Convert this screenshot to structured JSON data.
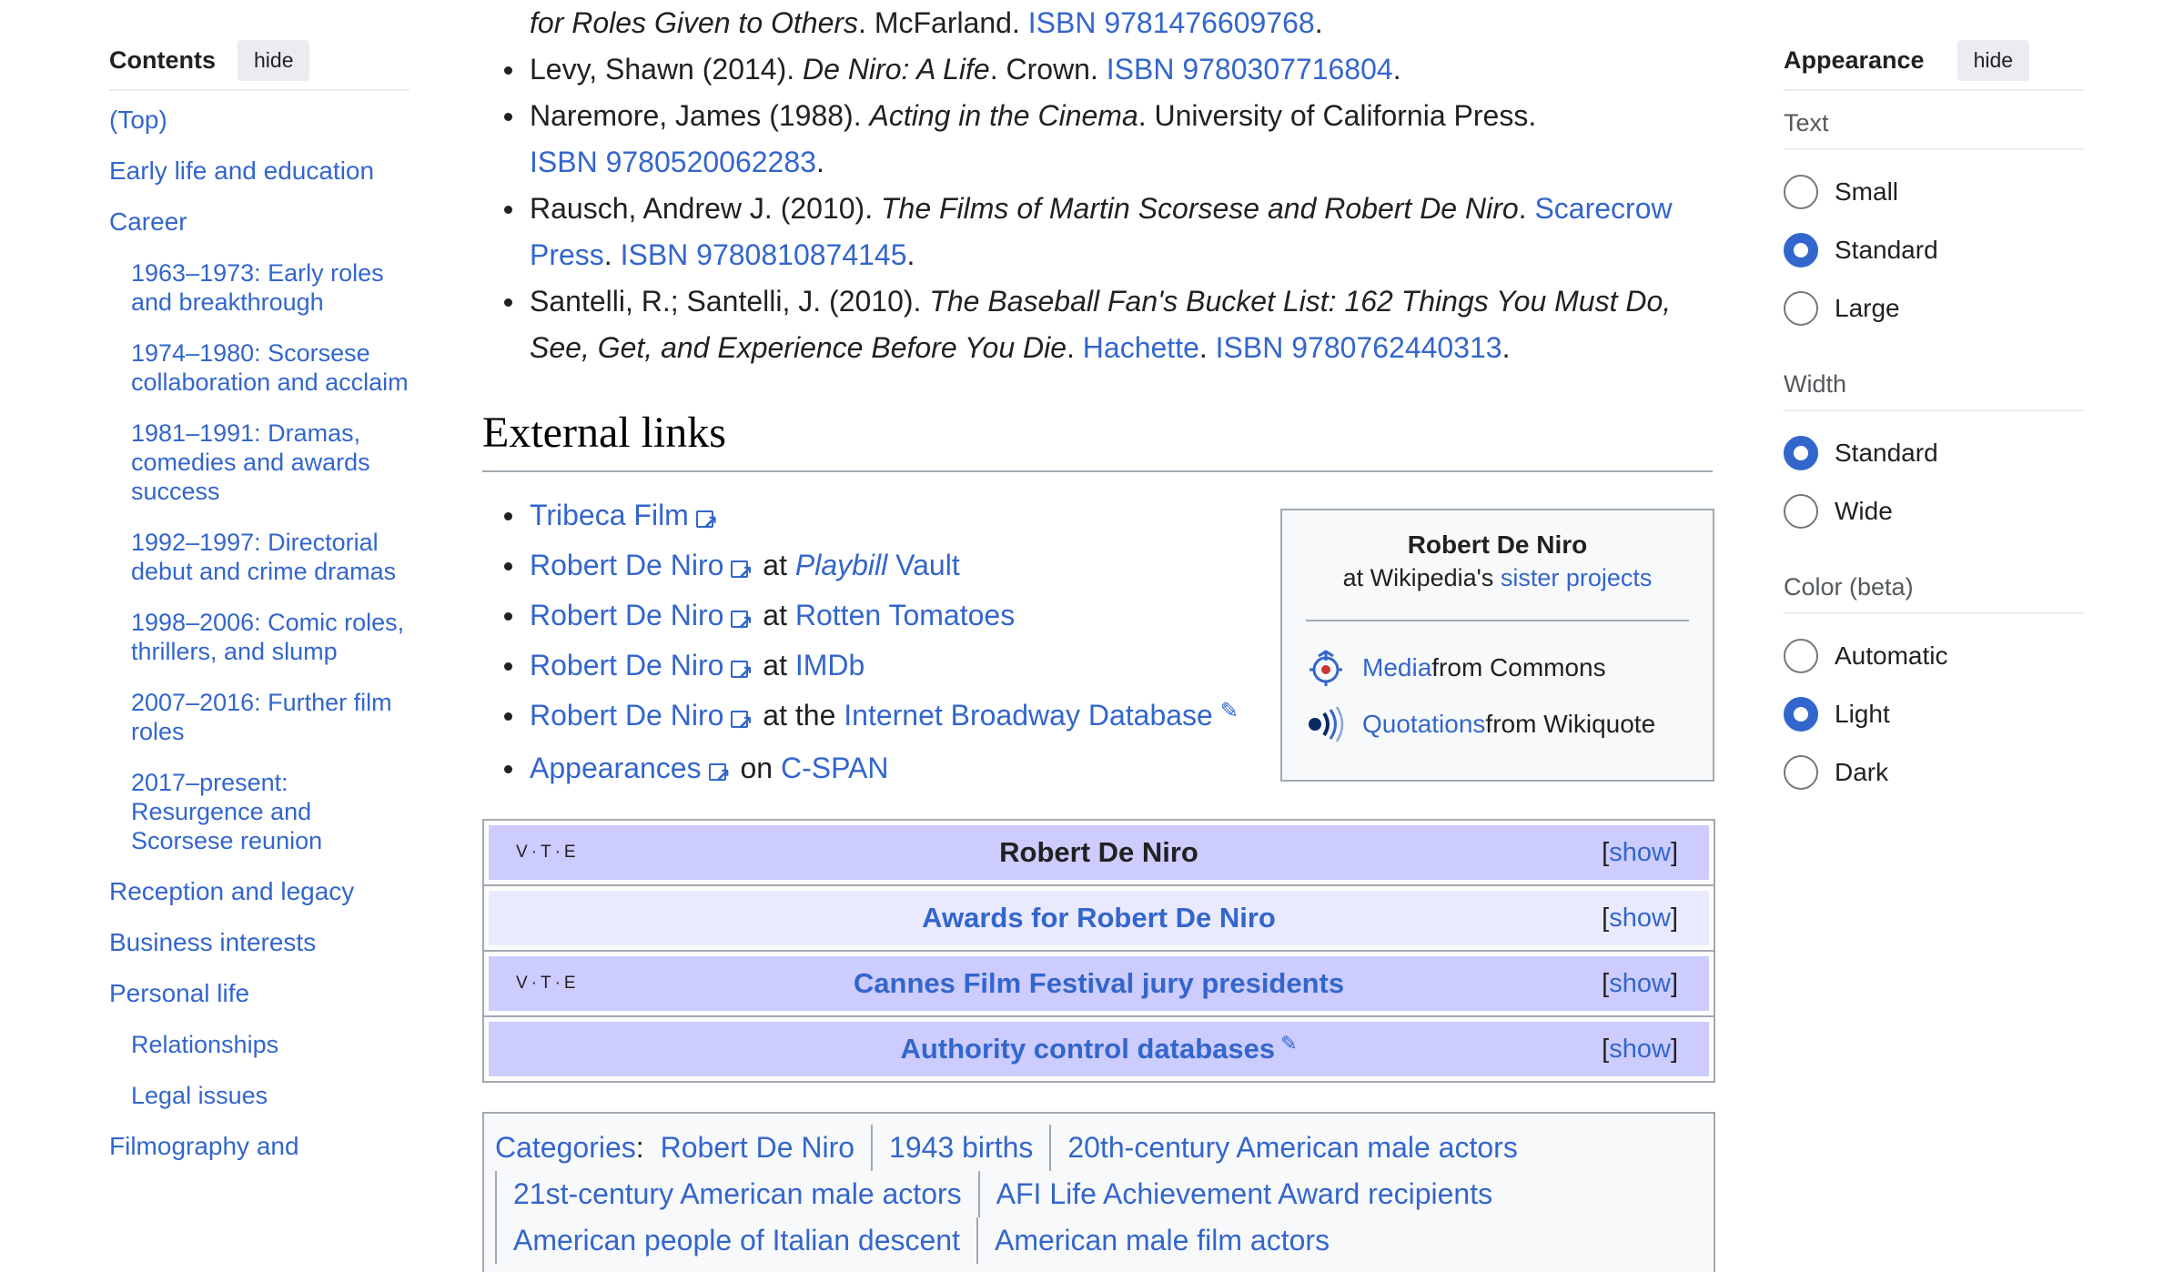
{
  "toc": {
    "title": "Contents",
    "hide_label": "hide",
    "items": [
      {
        "label": "(Top)"
      },
      {
        "label": "Early life and education"
      },
      {
        "label": "Career"
      },
      {
        "label": "1963–1973: Early roles and breakthrough"
      },
      {
        "label": "1974–1980: Scorsese collaboration and acclaim"
      },
      {
        "label": "1981–1991: Dramas, comedies and awards success"
      },
      {
        "label": "1992–1997: Directorial debut and crime dramas"
      },
      {
        "label": "1998–2006: Comic roles, thrillers, and slump"
      },
      {
        "label": "2007–2016: Further film roles"
      },
      {
        "label": "2017–present: Resurgence and Scorsese reunion"
      },
      {
        "label": "Reception and legacy"
      },
      {
        "label": "Business interests"
      },
      {
        "label": "Personal life"
      },
      {
        "label": "Relationships"
      },
      {
        "label": "Legal issues"
      },
      {
        "label": "Filmography and"
      }
    ]
  },
  "refs": {
    "r0": {
      "italic": "for Roles Given to Others",
      "text": ". McFarland. ",
      "isbn": "ISBN 9781476609768",
      "end": "."
    },
    "r1": {
      "text": "Levy, Shawn (2014). ",
      "italic": "De Niro: A Life",
      "text2": ". Crown. ",
      "isbn": "ISBN 9780307716804",
      "end": "."
    },
    "r2": {
      "text": "Naremore, James (1988). ",
      "italic": "Acting in the Cinema",
      "text2": ". University of California Press.",
      "isbn": "ISBN 9780520062283",
      "end": "."
    },
    "r3": {
      "text": "Rausch, Andrew J. (2010). ",
      "italic": "The Films of Martin Scorsese and Robert De Niro",
      "text2": ". ",
      "publisher": "Scarecrow Press",
      "text3": ". ",
      "isbn": "ISBN 9780810874145",
      "end": "."
    },
    "r4": {
      "text": "Santelli, R.; Santelli, J. (2010). ",
      "italic1": "The Baseball Fan's Bucket List: 162 Things You Must Do,",
      "italic2": "See, Get, and Experience Before You Die",
      "text2": ". ",
      "publisher": "Hachette",
      "text3": ". ",
      "isbn": "ISBN 9780762440313",
      "end": "."
    }
  },
  "external_links": {
    "heading": "External links",
    "items": [
      {
        "link": "Tribeca Film"
      },
      {
        "link": "Robert De Niro",
        "mid": " at ",
        "site_italic": "Playbill",
        "site": " Vault"
      },
      {
        "link": "Robert De Niro",
        "mid": " at ",
        "site": "Rotten Tomatoes"
      },
      {
        "link": "Robert De Niro",
        "mid": " at ",
        "site": "IMDb"
      },
      {
        "link": "Robert De Niro",
        "mid": " at the ",
        "site": "Internet Broadway Database"
      },
      {
        "link": "Appearances",
        "mid": " on ",
        "site": "C-SPAN"
      }
    ],
    "sister": {
      "title": "Robert De Niro",
      "sub_pre": "at Wikipedia's ",
      "sub_link": "sister projects",
      "rows": [
        {
          "link": "Media",
          "text": " from Commons",
          "icon": "commons-icon"
        },
        {
          "link": "Quotations",
          "text": " from Wikiquote",
          "icon": "wikiquote-icon"
        }
      ]
    }
  },
  "navboxes": [
    {
      "vte": "V·T·E",
      "title": "Robert De Niro",
      "show": "[show]"
    },
    {
      "vte": "",
      "title": "Awards for Robert De Niro",
      "show": "[show]"
    },
    {
      "vte": "V·T·E",
      "title": "Cannes Film Festival jury presidents",
      "show": "[show]"
    },
    {
      "vte": "",
      "title": "Authority control databases",
      "show": "[show]"
    }
  ],
  "categories": {
    "label": "Categories",
    "rows": [
      [
        "Robert De Niro",
        "1943 births",
        "20th-century American male actors"
      ],
      [
        "21st-century American male actors",
        "AFI Life Achievement Award recipients"
      ],
      [
        "American people of Italian descent",
        "American male film actors"
      ]
    ]
  },
  "appearance": {
    "title": "Appearance",
    "hide_label": "hide",
    "text_section": "Text",
    "text_options": [
      "Small",
      "Standard",
      "Large"
    ],
    "text_selected": "Standard",
    "width_section": "Width",
    "width_options": [
      "Standard",
      "Wide"
    ],
    "width_selected": "Standard",
    "color_section": "Color (beta)",
    "color_options": [
      "Automatic",
      "Light",
      "Dark"
    ],
    "color_selected": "Light"
  },
  "colors": {
    "link": "#3366cc",
    "navbox_title": "#ccccff",
    "navbox_light": "#eaeaff",
    "border": "#a2a9b1"
  }
}
